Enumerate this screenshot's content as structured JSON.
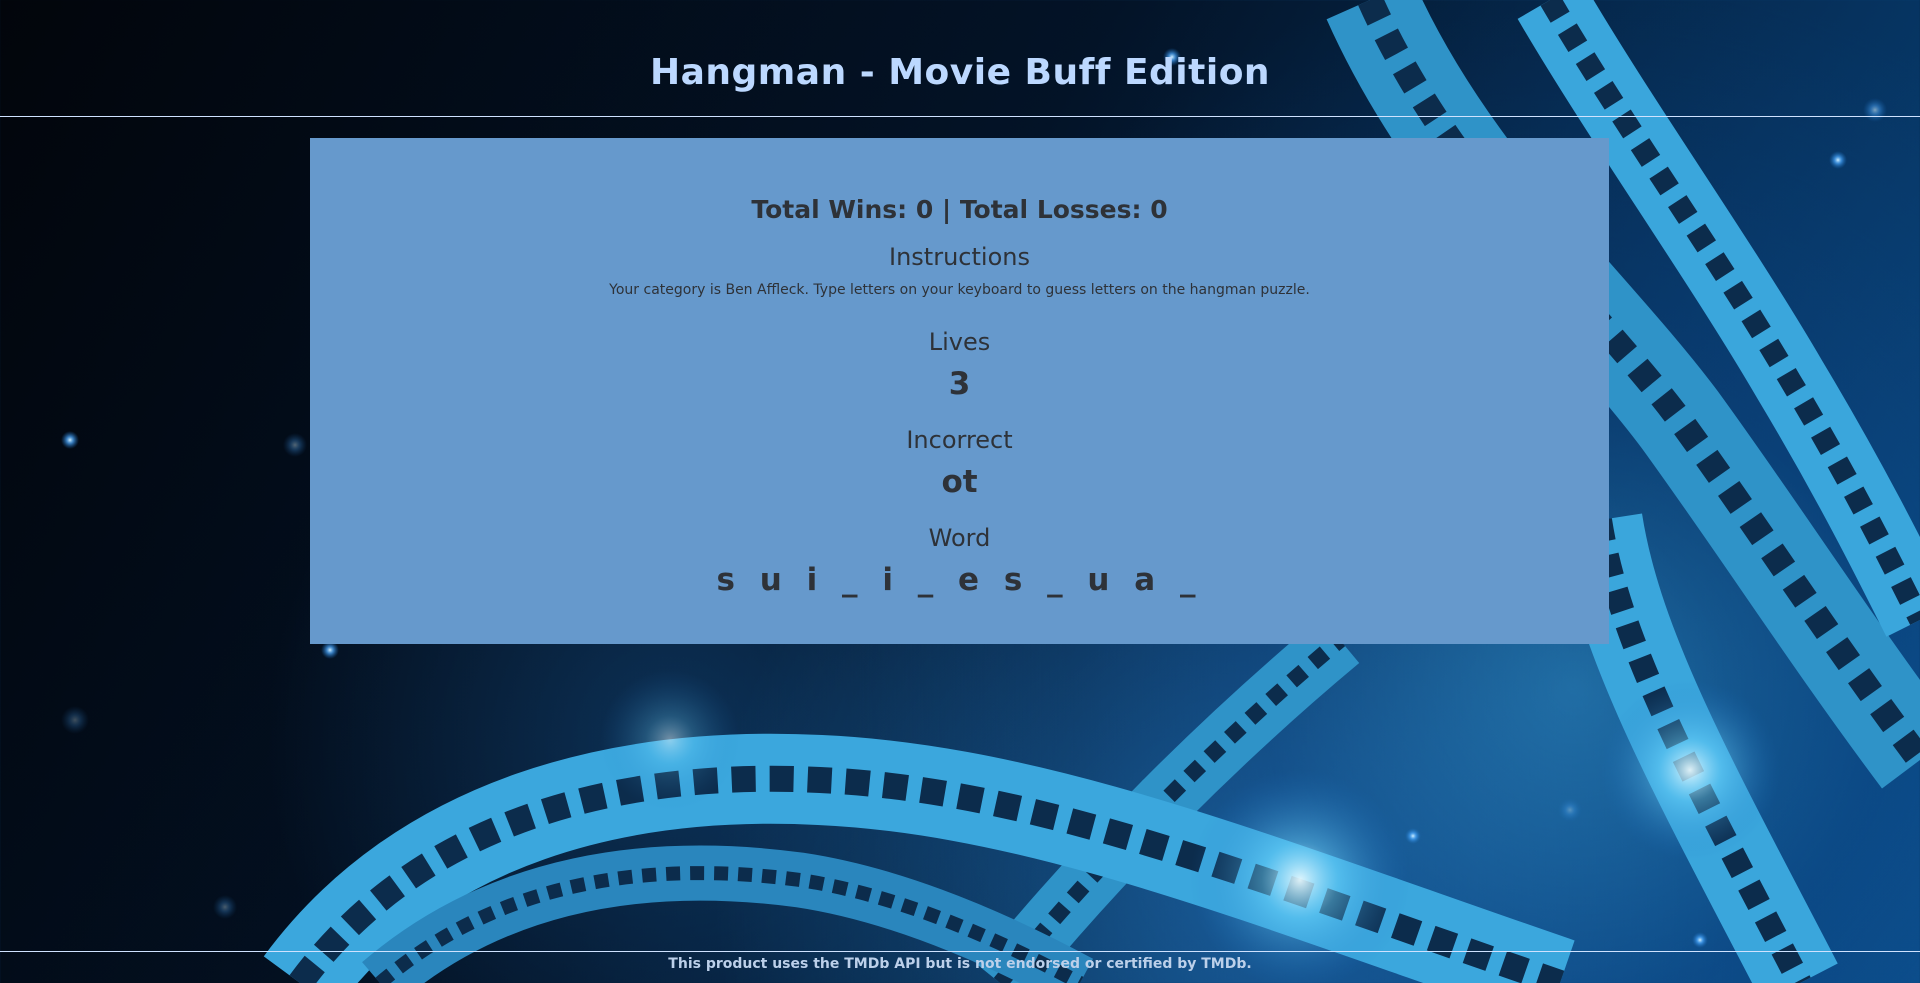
{
  "header": {
    "title": "Hangman - Movie Buff Edition"
  },
  "game": {
    "score_text": "Total Wins: 0 | Total Losses: 0",
    "instructions_heading": "Instructions",
    "instructions_text": "Your category is Ben Affleck. Type letters on your keyboard to guess letters on the hangman puzzle.",
    "lives_heading": "Lives",
    "lives_value": "3",
    "incorrect_heading": "Incorrect",
    "incorrect_value": "ot",
    "word_heading": "Word",
    "word_value": "s u i _ i _ e  s _ u a _"
  },
  "footer": {
    "text": "This product uses the TMDb API but is not endorsed or certified by TMDb."
  },
  "colors": {
    "panel": "#6699cc",
    "title": "#bcd8ff",
    "text": "#2e3238",
    "background_dark": "#02050b",
    "background_blue": "#0a4b86",
    "film": "#3ba7dd"
  },
  "background": {
    "image": "film-reel-background"
  }
}
